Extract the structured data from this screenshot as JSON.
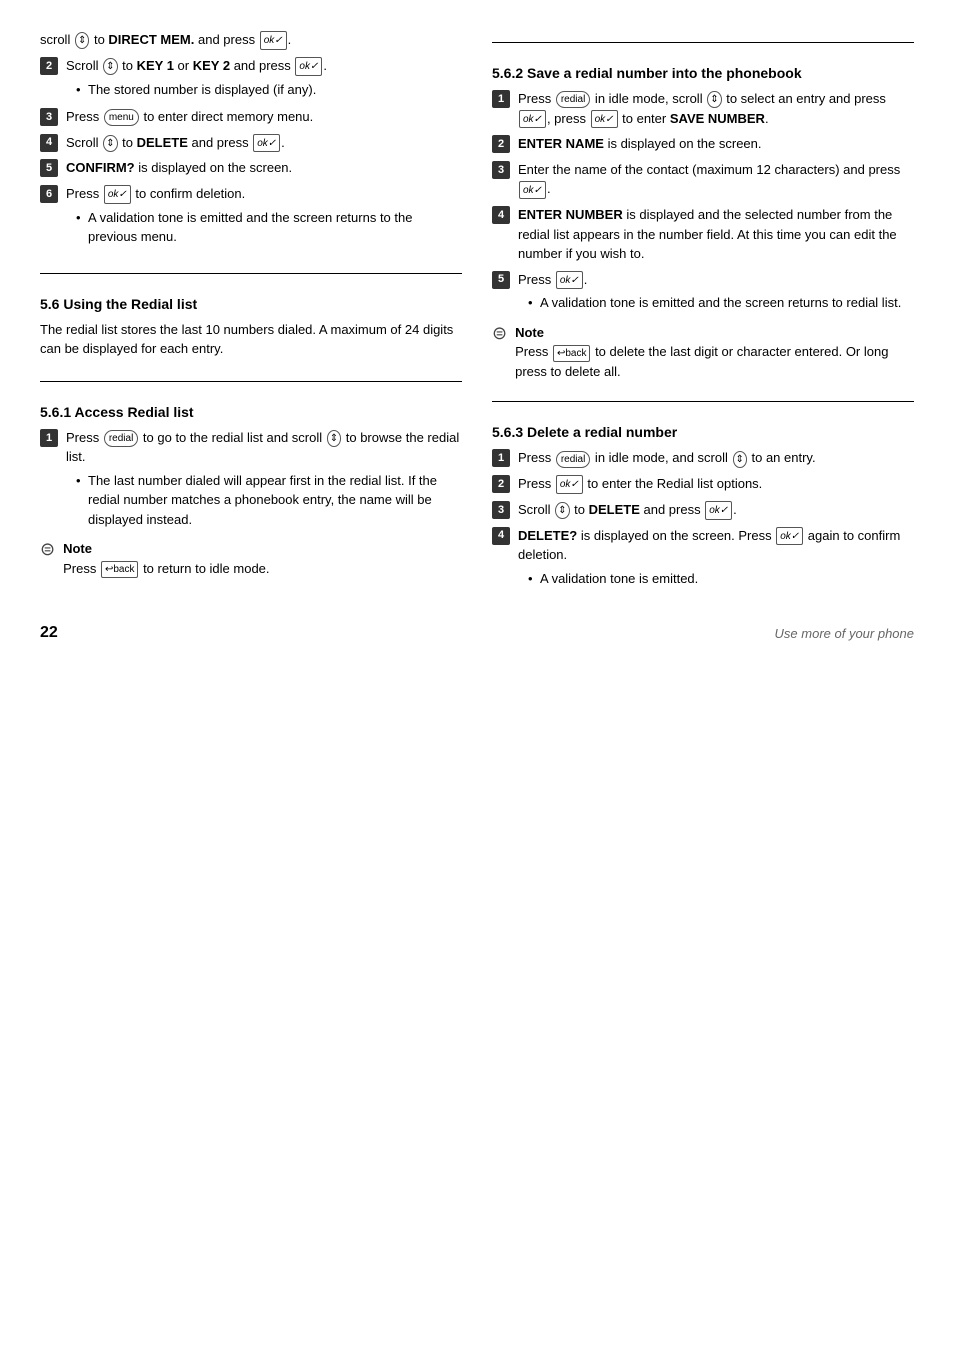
{
  "page": {
    "number": "22",
    "tagline": "Use more of your phone"
  },
  "leftCol": {
    "topSteps": [
      {
        "id": "top-blank",
        "text": "scroll",
        "icon": "scroll",
        "bold": "DIRECT MEM.",
        "after": " and press"
      }
    ],
    "steps": [
      {
        "num": "2",
        "text": "Scroll",
        "icon": "scroll",
        "middle": " to ",
        "bold1": "KEY 1",
        "and": " or ",
        "bold2": "KEY 2",
        "after": " and press",
        "icon2": "ok",
        "bullet": "The stored number is displayed (if any)."
      },
      {
        "num": "3",
        "text": "Press",
        "icon": "menu",
        "after": " to enter direct memory menu."
      },
      {
        "num": "4",
        "text": "Scroll",
        "icon": "scroll",
        "middle": " to ",
        "bold": "DELETE",
        "after": " and press",
        "icon2": "ok"
      },
      {
        "num": "5",
        "bold": "CONFIRM?",
        "after": " is displayed on the screen."
      },
      {
        "num": "6",
        "text": "Press",
        "icon": "ok",
        "after": " to confirm deletion.",
        "bullet": "A validation tone is emitted and the screen returns to the previous menu."
      }
    ],
    "section56": {
      "title": "5.6    Using the Redial list",
      "intro": "The redial list stores the last 10 numbers dialed. A maximum of 24 digits can be displayed for each entry."
    },
    "section561": {
      "title": "5.6.1   Access Redial list",
      "steps": [
        {
          "num": "1",
          "text": "Press",
          "icon": "redial",
          "after": " to go to the redial list and scroll",
          "icon2": "scroll",
          "after2": " to browse the redial list.",
          "bullet": "The last number dialed will appear first in the redial list. If the redial number matches a phonebook entry, the name will be displayed instead."
        }
      ],
      "note": {
        "title": "Note",
        "text": "Press",
        "icon": "back",
        "after": " to return to idle mode."
      }
    }
  },
  "rightCol": {
    "section562": {
      "title": "5.6.2   Save a redial number into the phonebook",
      "steps": [
        {
          "num": "1",
          "text": "Press",
          "icon": "redial",
          "after": " in idle mode, scroll",
          "icon2": "scroll",
          "after2": " to select an entry and press",
          "icon3": "ok",
          "after3": ", press",
          "icon4": "ok",
          "after4": " to enter ",
          "bold": "SAVE NUMBER"
        },
        {
          "num": "2",
          "bold": "ENTER NAME",
          "after": " is displayed on the screen."
        },
        {
          "num": "3",
          "text": "Enter the name of the contact (maximum 12 characters) and press",
          "icon": "ok"
        },
        {
          "num": "4",
          "bold": "ENTER NUMBER",
          "after": " is displayed and the selected number from the redial list appears in the number field. At this time you can edit the number if you wish to."
        },
        {
          "num": "5",
          "text": "Press",
          "icon": "ok",
          "bullet": "A validation tone is emitted and the screen returns to redial list."
        }
      ],
      "note": {
        "title": "Note",
        "text": "Press",
        "icon": "back",
        "after": " to delete the last digit or character entered. Or long press to delete all."
      }
    },
    "section563": {
      "title": "5.6.3   Delete a redial number",
      "steps": [
        {
          "num": "1",
          "text": "Press",
          "icon": "redial",
          "after": " in idle mode, and scroll",
          "icon2": "scroll",
          "after2": " to an entry."
        },
        {
          "num": "2",
          "text": "Press",
          "icon": "ok",
          "after": " to enter the Redial list options."
        },
        {
          "num": "3",
          "text": "Scroll",
          "icon": "scroll",
          "after": " to ",
          "bold": "DELETE",
          "after2": " and press",
          "icon2": "ok"
        },
        {
          "num": "4",
          "bold": "DELETE?",
          "after": " is displayed on the screen. Press",
          "icon": "ok",
          "after2": " again to confirm deletion.",
          "bullet": "A validation tone is emitted."
        }
      ]
    }
  }
}
